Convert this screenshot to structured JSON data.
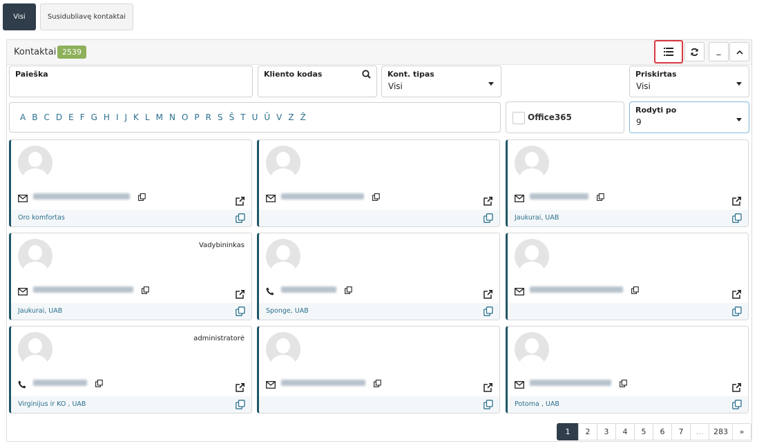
{
  "tabs": [
    {
      "label": "Visi",
      "active": true
    },
    {
      "label": "Susidubliavę kontaktai",
      "active": false
    }
  ],
  "header": {
    "title": "Kontaktai",
    "count": "2539"
  },
  "toolbar": {
    "icons": [
      "list-icon",
      "refresh-icon",
      "minimize-icon",
      "chevron-up-icon"
    ],
    "minimize_label": "_"
  },
  "filters": {
    "search_label": "Paieška",
    "client_code_label": "Kliento kodas",
    "contact_type_label": "Kont. tipas",
    "contact_type_value": "Visi",
    "assigned_label": "Priskirtas",
    "assigned_value": "Visi",
    "show_per_label": "Rodyti po",
    "show_per_value": "9",
    "office365_label": "Office365"
  },
  "alphabet": [
    "A",
    "B",
    "C",
    "D",
    "E",
    "F",
    "G",
    "H",
    "I",
    "J",
    "K",
    "L",
    "M",
    "N",
    "O",
    "P",
    "R",
    "S",
    "Š",
    "T",
    "U",
    "Ū",
    "V",
    "Z",
    "Ž"
  ],
  "cards": [
    {
      "role": "",
      "contact_type": "email",
      "company": "Oro komfortas"
    },
    {
      "role": "",
      "contact_type": "email",
      "company": ""
    },
    {
      "role": "",
      "contact_type": "email",
      "company": "Jaukurai, UAB"
    },
    {
      "role": "Vadybininkas",
      "contact_type": "email",
      "company": "Jaukurai, UAB"
    },
    {
      "role": "",
      "contact_type": "phone",
      "company": "Sponge, UAB"
    },
    {
      "role": "",
      "contact_type": "email",
      "company": ""
    },
    {
      "role": "administratorė",
      "contact_type": "phone",
      "company": "Virginijus ir KO , UAB"
    },
    {
      "role": "",
      "contact_type": "email",
      "company": ""
    },
    {
      "role": "",
      "contact_type": "email",
      "company": "Potoma , UAB"
    }
  ],
  "pagination": {
    "pages": [
      "1",
      "2",
      "3",
      "4",
      "5",
      "6",
      "7",
      "…",
      "283"
    ],
    "current": "1",
    "next": "»"
  },
  "colors": {
    "dark": "#2f3e4a",
    "badge": "#8db05a",
    "accent": "#1f5666",
    "link": "#2a6f8e",
    "highlight": "#d9383f"
  }
}
